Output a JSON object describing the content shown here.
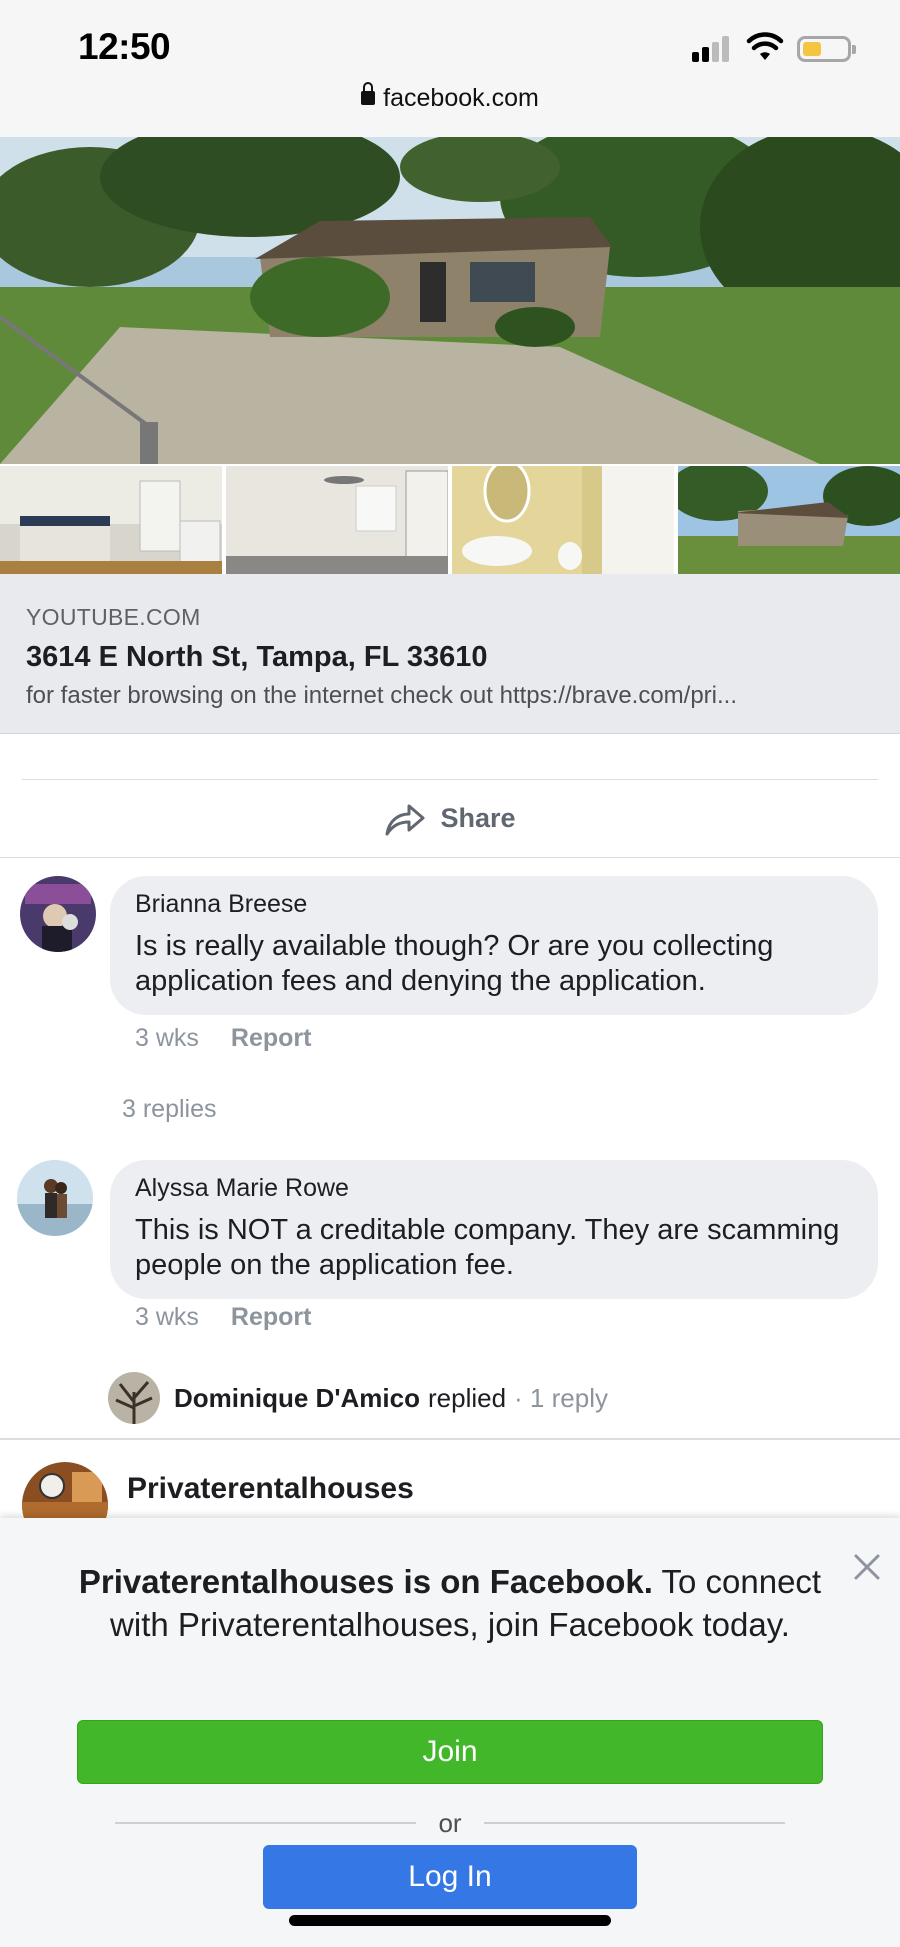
{
  "status_bar": {
    "time": "12:50",
    "url": "facebook.com",
    "icons": [
      "signal-icon",
      "wifi-icon",
      "battery-icon",
      "lock-icon"
    ],
    "battery_color": "#f5c442"
  },
  "link_preview": {
    "domain": "YOUTUBE.COM",
    "title": "3614 E North St, Tampa, FL 33610",
    "description": "for faster browsing on the internet check out https://brave.com/pri..."
  },
  "actions": {
    "share_label": "Share"
  },
  "comments": [
    {
      "author": "Brianna Breese",
      "text": "Is is really available though? Or are you collecting application fees and denying the application.",
      "time": "3 wks",
      "report_label": "Report"
    },
    {
      "author": "Alyssa Marie Rowe",
      "text": "This is NOT a creditable company. They are scamming people on the application fee.",
      "time": "3 wks",
      "report_label": "Report"
    }
  ],
  "replies_link": "3 replies",
  "reply_preview": {
    "name": "Dominique D'Amico",
    "action": "replied",
    "count": "· 1 reply"
  },
  "next_post": {
    "page_name": "Privaterentalhouses"
  },
  "signup_sheet": {
    "message_strong": "Privaterentalhouses is on Facebook.",
    "message_rest": "To connect with Privaterentalhouses, join Facebook today.",
    "join_label": "Join",
    "or_label": "or",
    "login_label": "Log In",
    "join_color": "#42b72a",
    "login_color": "#3578e5"
  }
}
